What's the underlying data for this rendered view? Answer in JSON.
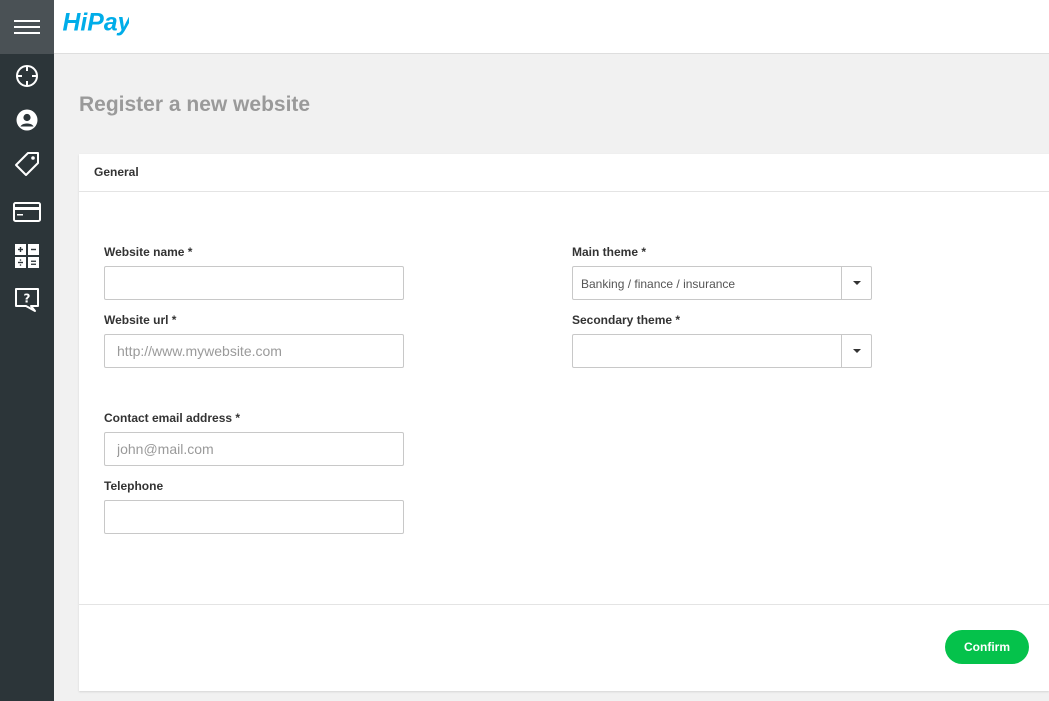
{
  "app": {
    "brand": "HiPay"
  },
  "sidebar": {
    "items": [
      {
        "icon": "dashboard-icon"
      },
      {
        "icon": "user-account-icon"
      },
      {
        "icon": "tag-icon"
      },
      {
        "icon": "credit-card-icon"
      },
      {
        "icon": "calculator-icon"
      },
      {
        "icon": "help-icon"
      }
    ]
  },
  "page": {
    "title": "Register a new website"
  },
  "form": {
    "section_title": "General",
    "website_name": {
      "label": "Website name *",
      "value": "",
      "placeholder": ""
    },
    "website_url": {
      "label": "Website url *",
      "value": "",
      "placeholder": "http://www.mywebsite.com"
    },
    "contact_email": {
      "label": "Contact email address *",
      "value": "",
      "placeholder": "john@mail.com"
    },
    "telephone": {
      "label": "Telephone",
      "value": "",
      "placeholder": ""
    },
    "main_theme": {
      "label": "Main theme *",
      "selected": "Banking / finance / insurance"
    },
    "secondary_theme": {
      "label": "Secondary theme *",
      "selected": ""
    },
    "confirm_label": "Confirm"
  },
  "colors": {
    "sidebar_bg": "#2c3539",
    "menu_button_bg": "#4a5155",
    "brand_blue": "#00ade9",
    "confirm_green": "#05c24b",
    "title_gray": "#9a9a9a"
  }
}
